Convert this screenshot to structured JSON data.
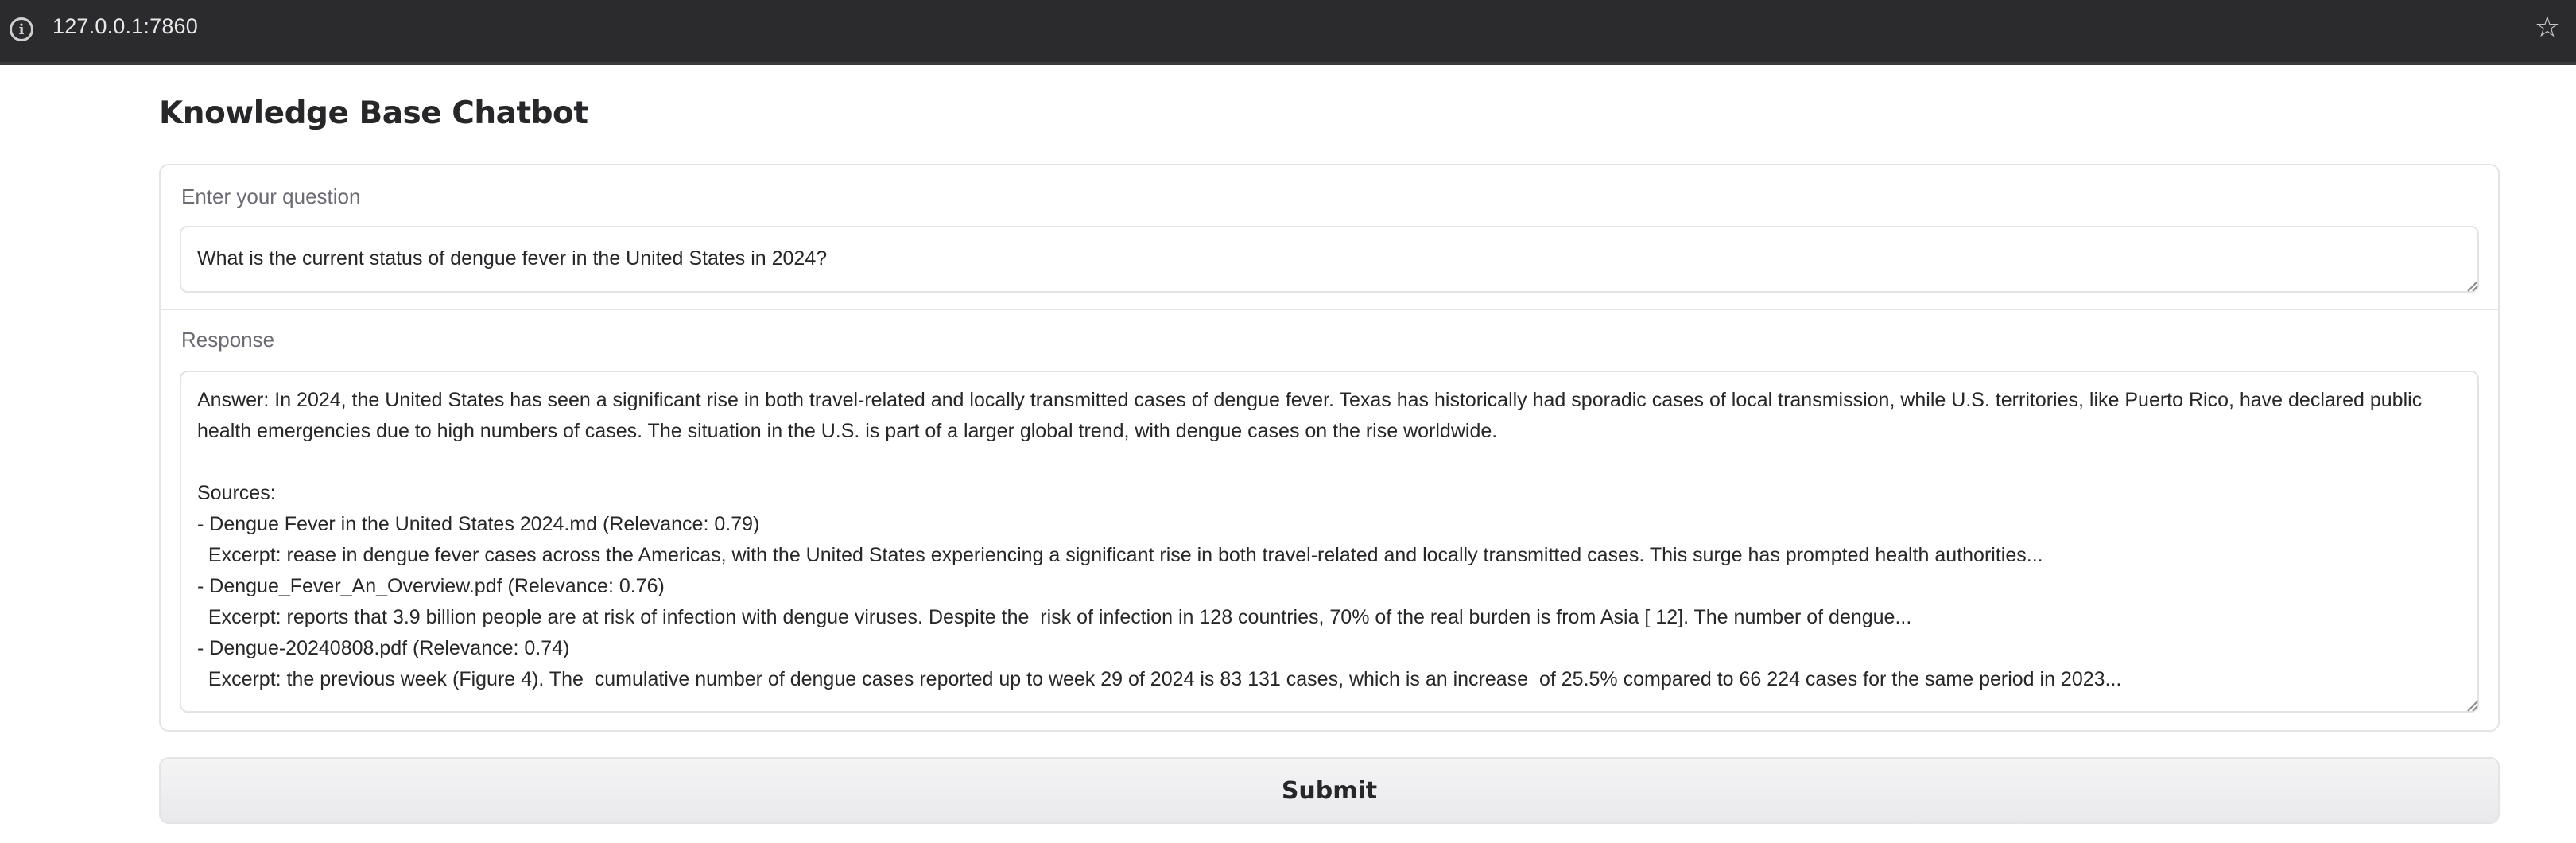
{
  "browser": {
    "url": "127.0.0.1:7860",
    "info_icon": "info-icon",
    "bookmark_icon": "star-icon"
  },
  "app": {
    "title": "Knowledge Base Chatbot"
  },
  "question": {
    "label": "Enter your question",
    "value": "What is the current status of dengue fever in the United States in 2024?"
  },
  "response": {
    "label": "Response",
    "value": "Answer: In 2024, the United States has seen a significant rise in both travel-related and locally transmitted cases of dengue fever. Texas has historically had sporadic cases of local transmission, while U.S. territories, like Puerto Rico, have declared public health emergencies due to high numbers of cases. The situation in the U.S. is part of a larger global trend, with dengue cases on the rise worldwide.\n\nSources:\n- Dengue Fever in the United States 2024.md (Relevance: 0.79)\n  Excerpt: rease in dengue fever cases across the Americas, with the United States experiencing a significant rise in both travel-related and locally transmitted cases. This surge has prompted health authorities...\n- Dengue_Fever_An_Overview.pdf (Relevance: 0.76)\n  Excerpt: reports that 3.9 billion people are at risk of infection with dengue viruses. Despite the  risk of infection in 128 countries, 70% of the real burden is from Asia [ 12]. The number of dengue...\n- Dengue-20240808.pdf (Relevance: 0.74)\n  Excerpt: the previous week (Figure 4). The  cumulative number of dengue cases reported up to week 29 of 2024 is 83 131 cases, which is an increase  of 25.5% compared to 66 224 cases for the same period in 2023..."
  },
  "submit": {
    "label": "Submit"
  }
}
